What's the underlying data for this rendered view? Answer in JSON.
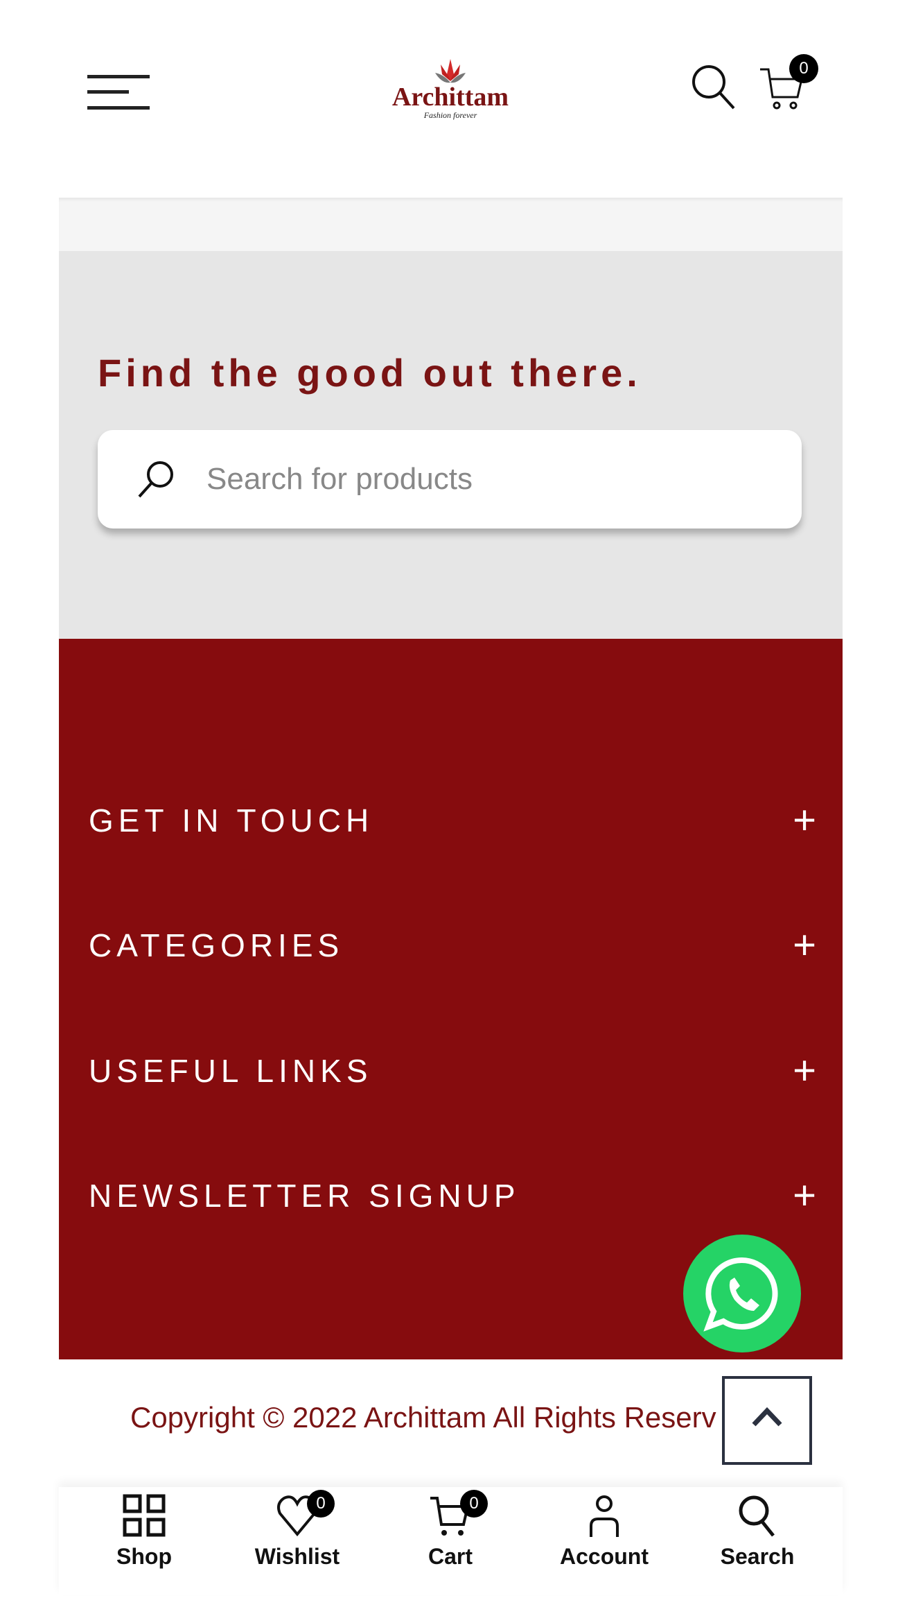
{
  "header": {
    "logo_text": "Archittam",
    "logo_tagline": "Fashion forever",
    "cart_count": "0",
    "icons": [
      "hamburger-menu-icon",
      "search-icon",
      "cart-icon"
    ]
  },
  "search": {
    "tagline": "Find the good out there.",
    "placeholder": "Search for products",
    "value": ""
  },
  "footer": {
    "sections": [
      {
        "label": "GET IN TOUCH"
      },
      {
        "label": "CATEGORIES"
      },
      {
        "label": "USEFUL LINKS"
      },
      {
        "label": "NEWSLETTER SIGNUP"
      }
    ],
    "expand_symbol": "+",
    "copyright": "Copyright © 2022 Archittam All Rights Reserv"
  },
  "bottom_nav": {
    "items": [
      {
        "label": "Shop",
        "icon": "grid-icon"
      },
      {
        "label": "Wishlist",
        "icon": "heart-icon",
        "count": "0"
      },
      {
        "label": "Cart",
        "icon": "cart-icon",
        "count": "0"
      },
      {
        "label": "Account",
        "icon": "user-icon"
      },
      {
        "label": "Search",
        "icon": "search-icon"
      }
    ]
  },
  "colors": {
    "brand": "#860c0e",
    "tagline": "#7a1414",
    "whatsapp": "#25d366",
    "search_bg": "#e6e6e6"
  }
}
